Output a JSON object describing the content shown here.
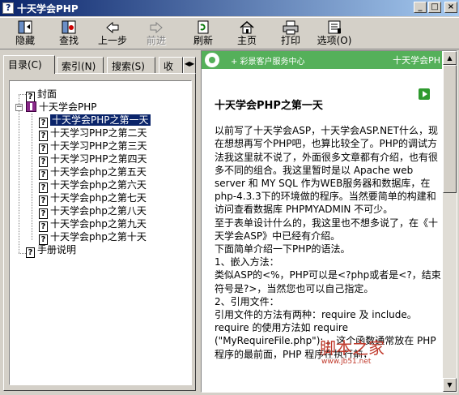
{
  "window": {
    "title": "十天学会PHP",
    "buttons": [
      "_",
      "□",
      "×"
    ]
  },
  "toolbar": {
    "items": [
      {
        "label": "隐藏",
        "icon": "hide-icon"
      },
      {
        "label": "查找",
        "icon": "locate-icon"
      },
      {
        "label": "上一步",
        "icon": "back-arrow-icon"
      },
      {
        "label": "前进",
        "icon": "forward-arrow-icon",
        "disabled": true
      },
      {
        "label": "刷新",
        "icon": "refresh-icon"
      },
      {
        "label": "主页",
        "icon": "home-icon"
      },
      {
        "label": "打印",
        "icon": "print-icon"
      },
      {
        "label": "选项(O)",
        "icon": "options-icon"
      }
    ]
  },
  "tabs": [
    {
      "label": "目录(C)",
      "active": true
    },
    {
      "label": "索引(N)"
    },
    {
      "label": "搜索(S)"
    },
    {
      "label": "收"
    }
  ],
  "tree": {
    "items": [
      {
        "label": "封面",
        "icon": "help-page-icon"
      },
      {
        "label": "十天学会PHP",
        "icon": "book-icon",
        "expanded": true
      },
      {
        "label": "十天学会PHP之第一天",
        "icon": "help-page-icon",
        "selected": true
      },
      {
        "label": "十天学习PHP之第二天",
        "icon": "help-page-icon"
      },
      {
        "label": "十天学习PHP之第三天",
        "icon": "help-page-icon"
      },
      {
        "label": "十天学习PHP之第四天",
        "icon": "help-page-icon"
      },
      {
        "label": "十天学会php之第五天",
        "icon": "help-page-icon"
      },
      {
        "label": "十天学会php之第六天",
        "icon": "help-page-icon"
      },
      {
        "label": "十天学会php之第七天",
        "icon": "help-page-icon"
      },
      {
        "label": "十天学会php之第八天",
        "icon": "help-page-icon"
      },
      {
        "label": "十天学会php之第九天",
        "icon": "help-page-icon"
      },
      {
        "label": "十天学会php之第十天",
        "icon": "help-page-icon"
      },
      {
        "label": "手册说明",
        "icon": "help-page-icon"
      }
    ]
  },
  "banner": {
    "center": "+ 彩景客户服务中心",
    "right": "十天学会PH"
  },
  "document": {
    "title": "十天学会PHP之第一天",
    "lines": [
      "以前写了十天学会ASP，十天学会ASP.NET什么，现在想想再写个PHP吧，也算比较全了。PHP的调试方法我这里就不说了，外面很多文章都有介绍，也有很多不同的组合。我这里暂时是以 Apache web server 和 MY SQL 作为WEB服务器和数据库，在php-4.3.3下的环境做的程序。当然要简单的构建和访问查看数据库 PHPMYADMIN 不可少。",
      "至于表单设计什么的，我这里也不想多说了，在《十天学会ASP》中已经有介绍。",
      "下面简单介绍一下PHP的语法。",
      "1、嵌入方法：",
      "类似ASP的<%，PHP可以是<?php或者是<?，结束符号是?>，当然您也可以自己指定。",
      "2、引用文件：",
      "引用文件的方法有两种：require 及 include。",
      "require 的使用方法如 require (\"MyRequireFile.php\"); 。这个函数通常放在 PHP 程序的最前面，PHP 程序在执行前，"
    ]
  },
  "watermark": {
    "text": "脚本之家",
    "sub": "www.jb51.net"
  },
  "colors": {
    "selection": "#0a246a",
    "banner": "#55b05a",
    "title_gradient_start": "#0a246a"
  }
}
